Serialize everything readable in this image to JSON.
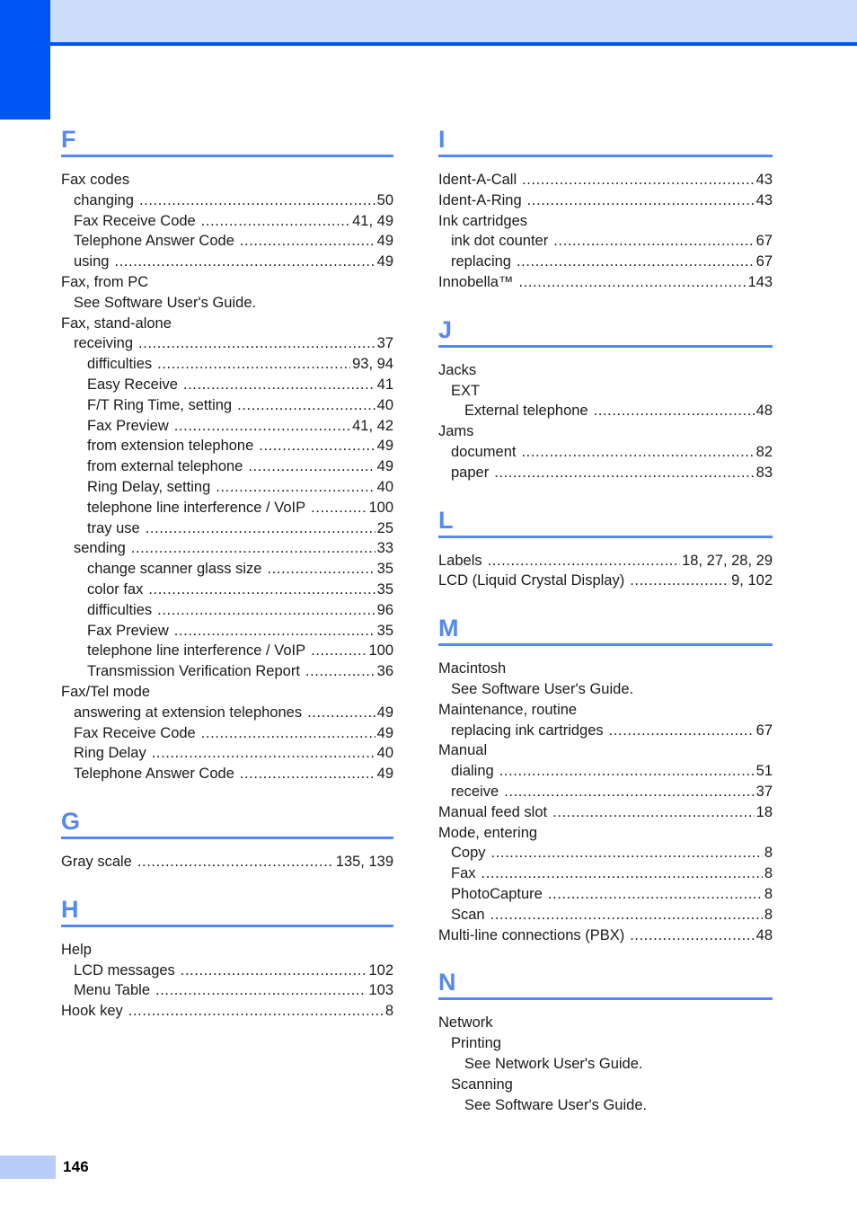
{
  "page": {
    "number": "146",
    "accent_color": "#0055f5",
    "heading_color": "#5588f0",
    "header_band_color": "#cddcfa",
    "footer_block_color": "#b7cdf7"
  },
  "columns": [
    {
      "name": "left",
      "sections": [
        {
          "letter": "F",
          "entries": [
            {
              "level": 0,
              "label": "Fax codes",
              "pages": ""
            },
            {
              "level": 1,
              "label": "changing",
              "pages": "50"
            },
            {
              "level": 1,
              "label": "Fax Receive Code",
              "pages": "41, 49"
            },
            {
              "level": 1,
              "label": "Telephone Answer Code",
              "pages": "49"
            },
            {
              "level": 1,
              "label": "using",
              "pages": "49"
            },
            {
              "level": 0,
              "label": "Fax, from PC",
              "pages": ""
            },
            {
              "level": 1,
              "label": "See Software User's Guide.",
              "pages": ""
            },
            {
              "level": 0,
              "label": "Fax, stand-alone",
              "pages": ""
            },
            {
              "level": 1,
              "label": "receiving",
              "pages": "37"
            },
            {
              "level": 2,
              "label": "difficulties",
              "pages": "93, 94"
            },
            {
              "level": 2,
              "label": "Easy Receive",
              "pages": "41"
            },
            {
              "level": 2,
              "label": "F/T Ring Time, setting",
              "pages": "40"
            },
            {
              "level": 2,
              "label": "Fax Preview",
              "pages": "41, 42"
            },
            {
              "level": 2,
              "label": "from extension telephone",
              "pages": "49"
            },
            {
              "level": 2,
              "label": "from external telephone",
              "pages": "49"
            },
            {
              "level": 2,
              "label": "Ring Delay, setting",
              "pages": "40"
            },
            {
              "level": 2,
              "label": "telephone line interference / VoIP",
              "pages": "100"
            },
            {
              "level": 2,
              "label": "tray use",
              "pages": "25"
            },
            {
              "level": 1,
              "label": "sending",
              "pages": "33"
            },
            {
              "level": 2,
              "label": "change scanner glass size",
              "pages": "35"
            },
            {
              "level": 2,
              "label": "color fax",
              "pages": "35"
            },
            {
              "level": 2,
              "label": "difficulties",
              "pages": "96"
            },
            {
              "level": 2,
              "label": "Fax Preview",
              "pages": "35"
            },
            {
              "level": 2,
              "label": "telephone line interference / VoIP",
              "pages": "100"
            },
            {
              "level": 2,
              "label": "Transmission Verification Report",
              "pages": "36"
            },
            {
              "level": 0,
              "label": "Fax/Tel mode",
              "pages": ""
            },
            {
              "level": 1,
              "label": "answering at extension telephones",
              "pages": "49"
            },
            {
              "level": 1,
              "label": "Fax Receive Code",
              "pages": "49"
            },
            {
              "level": 1,
              "label": "Ring Delay",
              "pages": "40"
            },
            {
              "level": 1,
              "label": "Telephone Answer Code",
              "pages": "49"
            }
          ]
        },
        {
          "letter": "G",
          "entries": [
            {
              "level": 0,
              "label": "Gray scale",
              "pages": "135, 139"
            }
          ]
        },
        {
          "letter": "H",
          "entries": [
            {
              "level": 0,
              "label": "Help",
              "pages": ""
            },
            {
              "level": 1,
              "label": "LCD messages",
              "pages": "102"
            },
            {
              "level": 1,
              "label": "Menu Table",
              "pages": "103"
            },
            {
              "level": 0,
              "label": "Hook key",
              "pages": "8"
            }
          ]
        }
      ]
    },
    {
      "name": "right",
      "sections": [
        {
          "letter": "I",
          "entries": [
            {
              "level": 0,
              "label": "Ident-A-Call",
              "pages": "43"
            },
            {
              "level": 0,
              "label": "Ident-A-Ring",
              "pages": "43"
            },
            {
              "level": 0,
              "label": "Ink cartridges",
              "pages": ""
            },
            {
              "level": 1,
              "label": "ink dot counter",
              "pages": "67"
            },
            {
              "level": 1,
              "label": "replacing",
              "pages": "67"
            },
            {
              "level": 0,
              "label": "Innobella™",
              "pages": "143"
            }
          ]
        },
        {
          "letter": "J",
          "entries": [
            {
              "level": 0,
              "label": "Jacks",
              "pages": ""
            },
            {
              "level": 1,
              "label": "EXT",
              "pages": ""
            },
            {
              "level": 2,
              "label": "External telephone",
              "pages": "48"
            },
            {
              "level": 0,
              "label": "Jams",
              "pages": ""
            },
            {
              "level": 1,
              "label": "document",
              "pages": "82"
            },
            {
              "level": 1,
              "label": "paper",
              "pages": "83"
            }
          ]
        },
        {
          "letter": "L",
          "entries": [
            {
              "level": 0,
              "label": "Labels",
              "pages": "18, 27, 28, 29"
            },
            {
              "level": 0,
              "label": "LCD (Liquid Crystal Display)",
              "pages": "9, 102"
            }
          ]
        },
        {
          "letter": "M",
          "entries": [
            {
              "level": 0,
              "label": "Macintosh",
              "pages": ""
            },
            {
              "level": 1,
              "label": "See Software User's Guide.",
              "pages": ""
            },
            {
              "level": 0,
              "label": "Maintenance, routine",
              "pages": ""
            },
            {
              "level": 1,
              "label": "replacing ink cartridges",
              "pages": "67"
            },
            {
              "level": 0,
              "label": "Manual",
              "pages": ""
            },
            {
              "level": 1,
              "label": "dialing",
              "pages": "51"
            },
            {
              "level": 1,
              "label": "receive",
              "pages": "37"
            },
            {
              "level": 0,
              "label": "Manual feed slot",
              "pages": "18"
            },
            {
              "level": 0,
              "label": "Mode, entering",
              "pages": ""
            },
            {
              "level": 1,
              "label": "Copy",
              "pages": "8"
            },
            {
              "level": 1,
              "label": "Fax",
              "pages": "8"
            },
            {
              "level": 1,
              "label": "PhotoCapture",
              "pages": "8"
            },
            {
              "level": 1,
              "label": "Scan",
              "pages": "8"
            },
            {
              "level": 0,
              "label": "Multi-line connections (PBX)",
              "pages": "48"
            }
          ]
        },
        {
          "letter": "N",
          "entries": [
            {
              "level": 0,
              "label": "Network",
              "pages": ""
            },
            {
              "level": 1,
              "label": "Printing",
              "pages": ""
            },
            {
              "level": 2,
              "label": "See Network User's Guide.",
              "pages": ""
            },
            {
              "level": 1,
              "label": "Scanning",
              "pages": ""
            },
            {
              "level": 2,
              "label": "See Software User's Guide.",
              "pages": ""
            }
          ]
        }
      ]
    }
  ]
}
